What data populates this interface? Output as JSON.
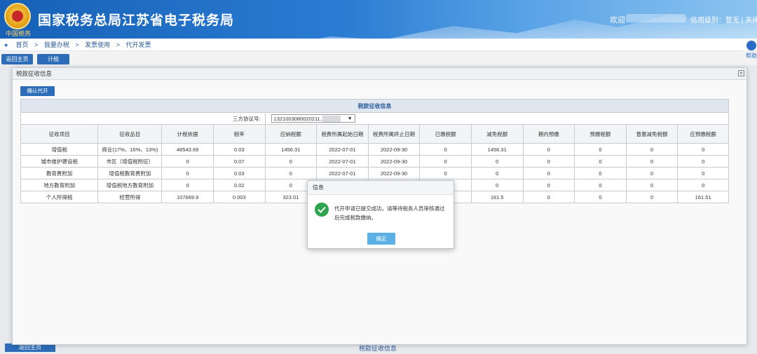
{
  "header": {
    "title": "国家税务总局江苏省电子税务局",
    "seal_text": "中国税务",
    "welcome": "欢迎",
    "userinfo": "信用级别：暂无 | 关闭"
  },
  "breadcrumb": [
    "首页",
    ">",
    "我要办税",
    ">",
    "发票使用",
    ">",
    "代开发票"
  ],
  "bg_toolbar": {
    "back_label": "返回主页",
    "calc_label": "计税"
  },
  "bg_right_label": "帮助",
  "dialog": {
    "title": "税款征收信息",
    "confirm_label": "确认代开",
    "section_title": "税款征收信息",
    "agreement_label": "三方协议号:",
    "agreement_value": "1321003080020211..."
  },
  "table": {
    "headers": [
      "征收项目",
      "征收品目",
      "计税依据",
      "税率",
      "应纳税额",
      "税费所属起始日期",
      "税费所属终止日期",
      "已缴税额",
      "减免税额",
      "期内预缴",
      "预缴税额",
      "普惠减免税额",
      "应预缴税额"
    ],
    "rows": [
      [
        "增值税",
        "商业(17%、16%、13%)",
        "48543.69",
        "0.03",
        "1456.31",
        "2022-07-01",
        "2022-09-30",
        "0",
        "1456.31",
        "0",
        "0",
        "0",
        "0"
      ],
      [
        "城市维护建设税",
        "市区（增值税附征）",
        "0",
        "0.07",
        "0",
        "2022-07-01",
        "2022-09-30",
        "0",
        "0",
        "0",
        "0",
        "0",
        "0"
      ],
      [
        "教育费附加",
        "增值税教育费附加",
        "0",
        "0.03",
        "0",
        "2022-07-01",
        "2022-09-30",
        "0",
        "0",
        "0",
        "0",
        "0",
        "0"
      ],
      [
        "地方教育附加",
        "增值税地方教育附加",
        "0",
        "0.02",
        "0",
        "",
        "",
        "",
        "0",
        "0",
        "0",
        "0",
        "0"
      ],
      [
        "个人所得税",
        "经营所得",
        "107669.9",
        "0.003",
        "323.01",
        "",
        "",
        "",
        "161.5",
        "0",
        "0",
        "0",
        "161.51"
      ]
    ]
  },
  "info_dialog": {
    "title": "信息",
    "message": "代开申请已提交成功，请等待税务人员审核通过后完成税款缴纳。",
    "ok_label": "确定"
  },
  "bg_bottom": {
    "button_label": "返回主页",
    "text": "税款征收信息"
  },
  "colors": {
    "header_blue": "#1761b8",
    "button_blue": "#2d6cb8",
    "success_green": "#2ea44f",
    "ok_blue": "#5bb1e6"
  }
}
